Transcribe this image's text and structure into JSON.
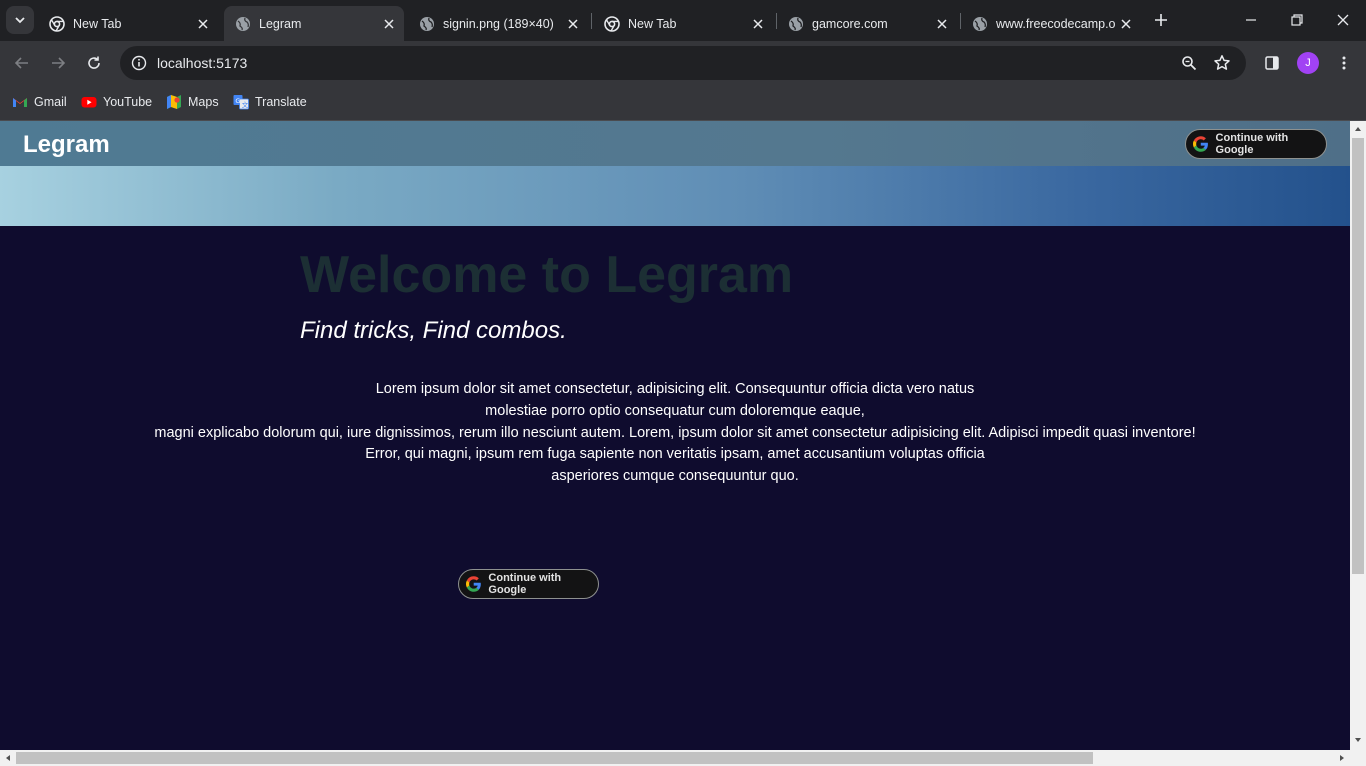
{
  "browser": {
    "tabs": [
      {
        "title": "New Tab",
        "icon": "chrome-icon",
        "active": false
      },
      {
        "title": "Legram",
        "icon": "globe-icon",
        "active": true
      },
      {
        "title": "signin.png (189×40)",
        "icon": "globe-icon",
        "active": false
      },
      {
        "title": "New Tab",
        "icon": "chrome-icon",
        "active": false
      },
      {
        "title": "gamcore.com",
        "icon": "globe-icon",
        "active": false
      },
      {
        "title": "www.freecodecamp.o",
        "icon": "globe-icon",
        "active": false
      }
    ],
    "url": "localhost:5173",
    "avatar_letter": "J",
    "avatar_color": "#a142f4",
    "bookmarks": [
      {
        "label": "Gmail",
        "icon": "gmail-icon"
      },
      {
        "label": "YouTube",
        "icon": "youtube-icon"
      },
      {
        "label": "Maps",
        "icon": "maps-icon"
      },
      {
        "label": "Translate",
        "icon": "translate-icon"
      }
    ]
  },
  "page": {
    "brand": "Legram",
    "nav_button_label": "Continue with Google",
    "hero_title": "Welcome to Legram",
    "hero_subtitle": "Find tricks, Find combos.",
    "body_lines": [
      "Lorem ipsum dolor sit amet consectetur, adipisicing elit. Consequuntur officia dicta vero natus",
      "molestiae porro optio consequatur cum doloremque eaque,",
      "magni explicabo dolorum qui, iure dignissimos, rerum illo nesciunt autem. Lorem, ipsum dolor sit amet consectetur adipisicing elit. Adipisci impedit quasi inventore!",
      "Error, qui magni, ipsum rem fuga sapiente non veritatis ipsam, amet accusantium voluptas officia",
      "asperiores cumque consequuntur quo."
    ],
    "cta_button_label": "Continue with Google",
    "colors": {
      "page_background": "#0f0c2e",
      "hero_title": "#1c2f34",
      "navbar": "#52788f"
    }
  }
}
